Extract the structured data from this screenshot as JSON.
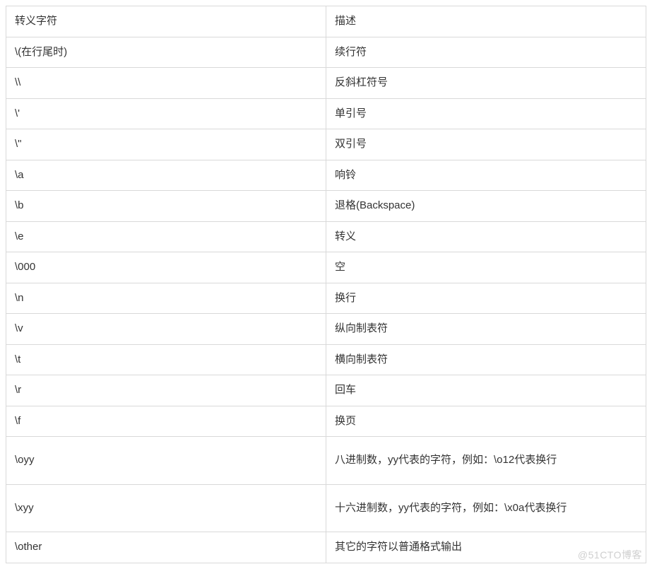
{
  "table": {
    "headers": {
      "char": "转义字符",
      "desc": "描述"
    },
    "rows": [
      {
        "char": "\\(在行尾时)",
        "desc": "续行符",
        "tall": false
      },
      {
        "char": "\\\\",
        "desc": "反斜杠符号",
        "tall": false
      },
      {
        "char": "\\'",
        "desc": "单引号",
        "tall": false
      },
      {
        "char": "\\\"",
        "desc": "双引号",
        "tall": false
      },
      {
        "char": "\\a",
        "desc": "响铃",
        "tall": false
      },
      {
        "char": "\\b",
        "desc": "退格(Backspace)",
        "tall": false
      },
      {
        "char": "\\e",
        "desc": "转义",
        "tall": false
      },
      {
        "char": "\\000",
        "desc": "空",
        "tall": false
      },
      {
        "char": "\\n",
        "desc": "换行",
        "tall": false
      },
      {
        "char": "\\v",
        "desc": "纵向制表符",
        "tall": false
      },
      {
        "char": "\\t",
        "desc": "横向制表符",
        "tall": false
      },
      {
        "char": "\\r",
        "desc": "回车",
        "tall": false
      },
      {
        "char": "\\f",
        "desc": "换页",
        "tall": false
      },
      {
        "char": "\\oyy",
        "desc": "八进制数，yy代表的字符，例如：\\o12代表换行",
        "tall": true
      },
      {
        "char": "\\xyy",
        "desc": "十六进制数，yy代表的字符，例如：\\x0a代表换行",
        "tall": true
      },
      {
        "char": "\\other",
        "desc": "其它的字符以普通格式输出",
        "tall": false
      }
    ]
  },
  "watermark": "@51CTO博客"
}
